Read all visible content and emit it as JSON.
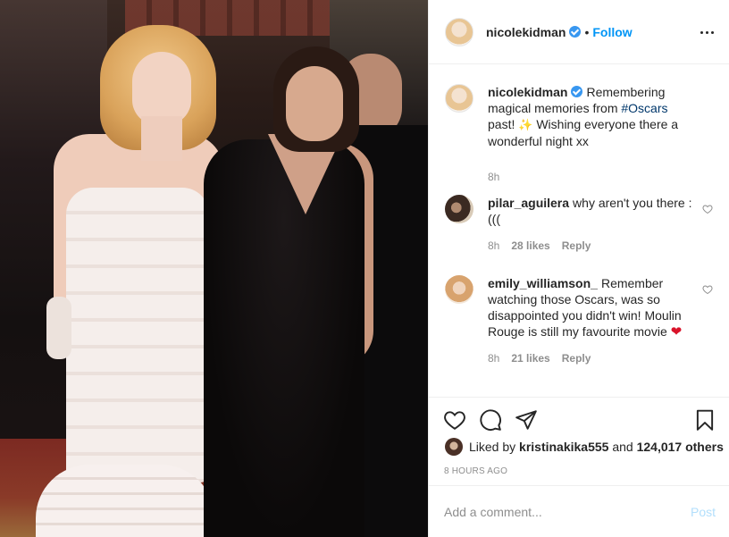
{
  "header": {
    "username": "nicolekidman",
    "separator": "•",
    "follow_label": "Follow"
  },
  "caption": {
    "username": "nicolekidman",
    "text_before": "Remembering magical memories from ",
    "hashtag": "#Oscars",
    "text_after": " past! ",
    "sparkle": "✨",
    "text_end": " Wishing everyone there a wonderful night xx",
    "age": "8h"
  },
  "comments": [
    {
      "username": "pilar_aguilera",
      "text": "why aren't you there :(((",
      "age": "8h",
      "likes": "28 likes",
      "reply": "Reply"
    },
    {
      "username": "emily_williamson_",
      "text": "Remember watching those Oscars, was so disappointed you didn't win! Moulin Rouge is still my favourite movie ",
      "emoji": "❤",
      "age": "8h",
      "likes": "21 likes",
      "reply": "Reply"
    }
  ],
  "actions": {
    "icons": [
      "heart-icon",
      "comment-icon",
      "share-icon",
      "bookmark-icon"
    ]
  },
  "likes": {
    "prefix": "Liked by ",
    "user": "kristinakika555",
    "middle": " and ",
    "count": "124,017 others"
  },
  "timestamp": "8 HOURS AGO",
  "add_comment": {
    "placeholder": "Add a comment...",
    "post_label": "Post"
  },
  "colors": {
    "link_blue": "#0095f6",
    "verified_blue": "#3897f0",
    "hashtag": "#00376b",
    "muted": "#8e8e8e",
    "post_disabled": "#b2dffc"
  }
}
